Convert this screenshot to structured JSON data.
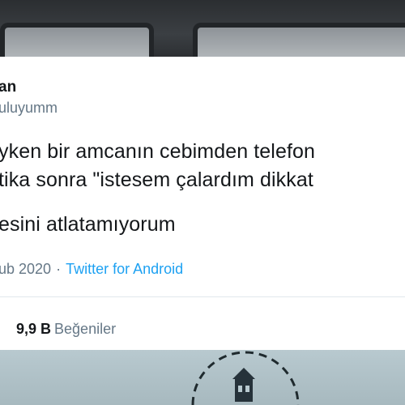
{
  "tweet": {
    "display_name": "an",
    "handle": "uluyumm",
    "text_lines": [
      "yken bir amcanın cebimden telefon",
      "tika sonra \"istesem çalardım dikkat",
      "esini atlatamıyorum"
    ],
    "date": "ub 2020",
    "separator": "·",
    "source": "Twitter for Android"
  },
  "stats": {
    "likes_count": "9,9 B",
    "likes_label": "Beğeniler"
  },
  "colors": {
    "text": "#14171a",
    "secondary": "#657786",
    "link": "#1da1f2",
    "divider": "#e1e8ed"
  }
}
